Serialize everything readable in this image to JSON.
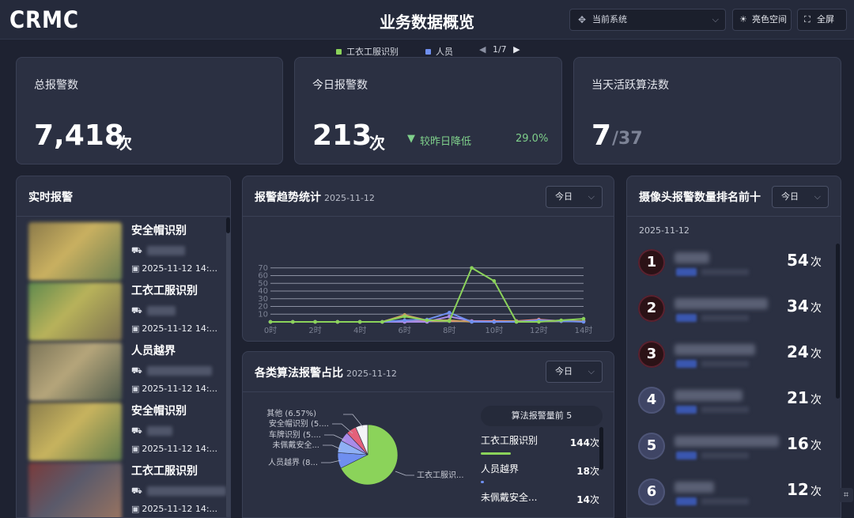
{
  "header": {
    "logo": "CRMC",
    "title": "业务数据概览",
    "system_select": "当前系统",
    "light_mode_label": "亮色空间",
    "fullscreen_label": "全屏"
  },
  "stats": {
    "total": {
      "label": "总报警数",
      "value": "7,418",
      "unit": "次"
    },
    "today": {
      "label": "今日报警数",
      "value": "213",
      "unit": "次",
      "trend_label": "较昨日降低",
      "trend_pct": "29.0%",
      "trend_arrow": "▼"
    },
    "active": {
      "label": "当天活跃算法数",
      "value": "7",
      "suffix": "/37"
    }
  },
  "realtime": {
    "title": "实时报警",
    "items": [
      {
        "name": "安全帽识别",
        "time": "2025-11-12 14:...",
        "colors": [
          "#8b7a4a",
          "#c9b060",
          "#6b7e52"
        ]
      },
      {
        "name": "工衣工服识别",
        "time": "2025-11-12 14:...",
        "colors": [
          "#5f8a4e",
          "#b8b25a",
          "#7a6f50"
        ]
      },
      {
        "name": "人员越界",
        "time": "2025-11-12 14:...",
        "colors": [
          "#7b7458",
          "#b5a57a",
          "#4f5b4b"
        ]
      },
      {
        "name": "安全帽识别",
        "time": "2025-11-12 14:...",
        "colors": [
          "#8a7d4c",
          "#c7b35e",
          "#5f7a4c"
        ]
      },
      {
        "name": "工衣工服识别",
        "time": "2025-11-12 14:...",
        "colors": [
          "#7a3b3b",
          "#5a5a6b",
          "#9a7460"
        ]
      }
    ]
  },
  "trend": {
    "title": "报警趋势统计",
    "date": "2025-11-12",
    "range": "今日",
    "pager": "1/7",
    "legend": [
      {
        "name": "工衣工服识别",
        "color": "#8bd35a"
      },
      {
        "name": "人员",
        "color": "#6f8ff0"
      }
    ]
  },
  "pie": {
    "title": "各类算法报警占比",
    "date": "2025-11-12",
    "range": "今日",
    "labels": {
      "other": "其他 (6.57%)",
      "helmet": "安全帽识别 (5....",
      "plate": "车牌识别 (5....",
      "noequip": "未佩戴安全...",
      "cross": "人员越界 (8...",
      "uniform": "工衣工服识..."
    },
    "side_title": "算法报警量前 5",
    "side_items": [
      {
        "name": "工衣工服识别",
        "count": "144",
        "unit": "次",
        "color": "#8bd35a"
      },
      {
        "name": "人员越界",
        "count": "18",
        "unit": "次",
        "color": "#6f8ff0"
      },
      {
        "name": "未佩戴安全...",
        "count": "14",
        "unit": "次",
        "color": "#a98be8"
      }
    ]
  },
  "ranking": {
    "title": "摄像头报警数量排名前十",
    "range": "今日",
    "date": "2025-11-12",
    "rows": [
      {
        "rank": "1",
        "count": "54",
        "unit": "次"
      },
      {
        "rank": "2",
        "count": "34",
        "unit": "次"
      },
      {
        "rank": "3",
        "count": "24",
        "unit": "次"
      },
      {
        "rank": "4",
        "count": "21",
        "unit": "次"
      },
      {
        "rank": "5",
        "count": "16",
        "unit": "次"
      },
      {
        "rank": "6",
        "count": "12",
        "unit": "次"
      }
    ]
  },
  "chart_data": [
    {
      "type": "line",
      "title": "报警趋势统计",
      "x": [
        "0时",
        "1时",
        "2时",
        "3时",
        "4时",
        "5时",
        "6时",
        "7时",
        "8时",
        "9时",
        "10时",
        "11时",
        "12时",
        "13时",
        "14时"
      ],
      "x_tick_labels": [
        "0时",
        "2时",
        "4时",
        "6时",
        "8时",
        "10时",
        "12时",
        "14时"
      ],
      "y_ticks": [
        10,
        20,
        30,
        40,
        50,
        60,
        70
      ],
      "ylim": [
        0,
        80
      ],
      "grid": true,
      "legend_position": "top",
      "series": [
        {
          "name": "工衣工服识别",
          "color": "#8bd35a",
          "values": [
            0,
            0,
            0,
            0,
            0,
            0,
            7,
            2,
            1,
            70,
            53,
            0,
            0,
            2,
            4
          ]
        },
        {
          "name": "人员",
          "color": "#6f8ff0",
          "values": [
            0,
            0,
            0,
            0,
            0,
            0,
            2,
            3,
            12,
            0,
            0,
            0,
            2,
            1,
            0
          ]
        },
        {
          "color": "#c9a060",
          "values": [
            0,
            0,
            0,
            0,
            0,
            0,
            9,
            2,
            2,
            0,
            0,
            1,
            1,
            1,
            1
          ]
        },
        {
          "color": "#a98be8",
          "values": [
            0,
            0,
            0,
            0,
            0,
            0,
            0,
            0,
            7,
            1,
            0,
            1,
            1,
            1,
            1
          ]
        },
        {
          "color": "#f28b82",
          "values": [
            0,
            0,
            0,
            0,
            0,
            0,
            0,
            1,
            1,
            1,
            1,
            1,
            3,
            1,
            1
          ]
        }
      ]
    },
    {
      "type": "pie",
      "title": "各类算法报警占比",
      "slices": [
        {
          "label": "工衣工服识别",
          "value": 67.6,
          "color": "#8bd35a"
        },
        {
          "label": "人员越界",
          "value": 8.5,
          "color": "#6f8ff0"
        },
        {
          "label": "未佩戴安全",
          "value": 6.6,
          "color": "#8fb0f5"
        },
        {
          "label": "车牌识别",
          "value": 5.2,
          "color": "#a98be8"
        },
        {
          "label": "安全帽识别",
          "value": 5.5,
          "color": "#e4607a"
        },
        {
          "label": "其他",
          "value": 6.57,
          "color": "#f4f4f8"
        }
      ]
    }
  ]
}
